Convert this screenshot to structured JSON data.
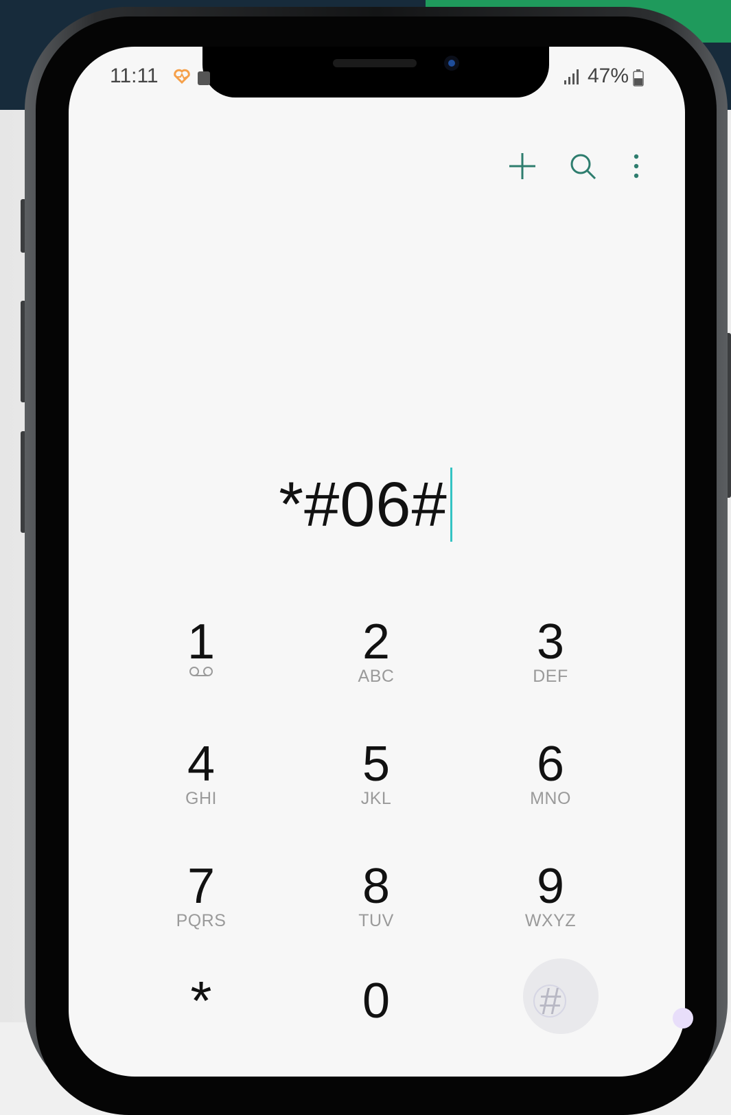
{
  "status_bar": {
    "time": "11:11",
    "battery_percent": "47%"
  },
  "toolbar": {
    "add_icon": "plus-icon",
    "search_icon": "search-icon",
    "menu_icon": "more-vertical-icon",
    "accent_color": "#2e7d6e"
  },
  "dialer": {
    "entered_number": "*#06#",
    "cursor_color": "#34c3c3"
  },
  "keypad": {
    "keys": [
      {
        "digit": "1",
        "letters": ""
      },
      {
        "digit": "2",
        "letters": "ABC"
      },
      {
        "digit": "3",
        "letters": "DEF"
      },
      {
        "digit": "4",
        "letters": "GHI"
      },
      {
        "digit": "5",
        "letters": "JKL"
      },
      {
        "digit": "6",
        "letters": "MNO"
      },
      {
        "digit": "7",
        "letters": "PQRS"
      },
      {
        "digit": "8",
        "letters": "TUV"
      },
      {
        "digit": "9",
        "letters": "WXYZ"
      },
      {
        "digit": "*",
        "letters": ""
      },
      {
        "digit": "0",
        "letters": ""
      },
      {
        "digit": "#",
        "letters": ""
      }
    ],
    "voicemail_icon": "voicemail-icon"
  }
}
